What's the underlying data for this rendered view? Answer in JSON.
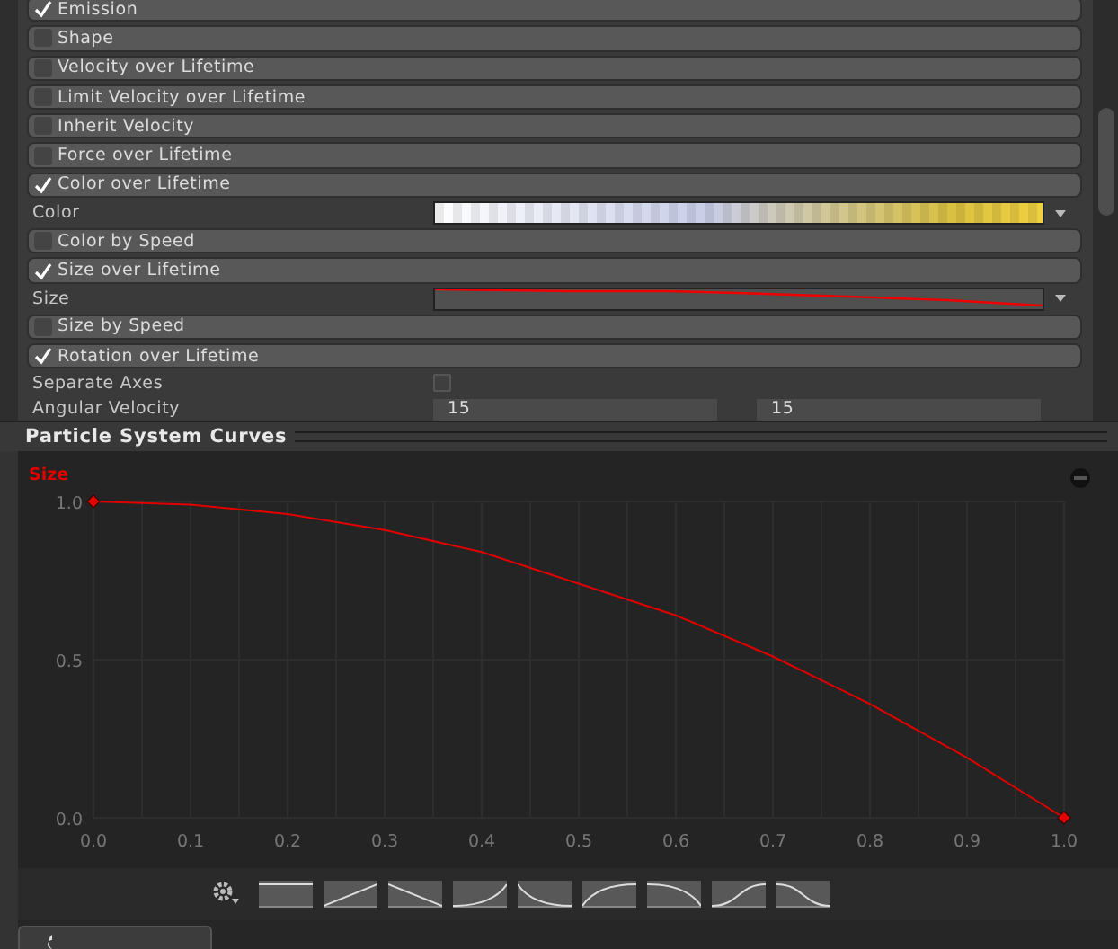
{
  "inspector": {
    "rows": [
      {
        "kind": "module",
        "label": "Emission",
        "checked": true
      },
      {
        "kind": "module",
        "label": "Shape",
        "checked": false
      },
      {
        "kind": "module",
        "label": "Velocity over Lifetime",
        "checked": false
      },
      {
        "kind": "module",
        "label": "Limit Velocity over Lifetime",
        "checked": false
      },
      {
        "kind": "module",
        "label": "Inherit Velocity",
        "checked": false
      },
      {
        "kind": "module",
        "label": "Force over Lifetime",
        "checked": false
      },
      {
        "kind": "module",
        "label": "Color over Lifetime",
        "checked": true
      },
      {
        "kind": "gradient",
        "label": "Color"
      },
      {
        "kind": "module",
        "label": "Color by Speed",
        "checked": false
      },
      {
        "kind": "module",
        "label": "Size over Lifetime",
        "checked": true
      },
      {
        "kind": "curve",
        "label": "Size"
      },
      {
        "kind": "module",
        "label": "Size by Speed",
        "checked": false
      },
      {
        "kind": "module",
        "label": "Rotation over Lifetime",
        "checked": true
      },
      {
        "kind": "toggle",
        "label": "Separate Axes",
        "checked": false
      },
      {
        "kind": "range",
        "label": "Angular Velocity",
        "values": [
          "15",
          "15"
        ]
      }
    ]
  },
  "curves_panel": {
    "title": "Particle System Curves",
    "chart_data": {
      "type": "line",
      "grid": true,
      "x": [
        0,
        0.1,
        0.2,
        0.3,
        0.4,
        0.5,
        0.6,
        0.7,
        0.8,
        0.9,
        1.0
      ],
      "series": [
        {
          "name": "Size",
          "color": "#e00000",
          "values": [
            1,
            0.99,
            0.96,
            0.91,
            0.84,
            0.74,
            0.64,
            0.51,
            0.36,
            0.19,
            0
          ]
        }
      ],
      "xlim": [
        0,
        1
      ],
      "ylim": [
        0,
        1
      ],
      "xticks": [
        {
          "value": 0,
          "label": "0.0"
        },
        {
          "value": 0.1,
          "label": "0.1"
        },
        {
          "value": 0.2,
          "label": "0.2"
        },
        {
          "value": 0.3,
          "label": "0.3"
        },
        {
          "value": 0.4,
          "label": "0.4"
        },
        {
          "value": 0.5,
          "label": "0.5"
        },
        {
          "value": 0.6,
          "label": "0.6"
        },
        {
          "value": 0.7,
          "label": "0.7"
        },
        {
          "value": 0.8,
          "label": "0.8"
        },
        {
          "value": 0.9,
          "label": "0.9"
        },
        {
          "value": 1,
          "label": "1.0"
        }
      ],
      "yticks": [
        {
          "value": 0,
          "label": "0.0"
        },
        {
          "value": 0.5,
          "label": "0.5"
        },
        {
          "value": 1,
          "label": "1.0"
        }
      ]
    }
  }
}
